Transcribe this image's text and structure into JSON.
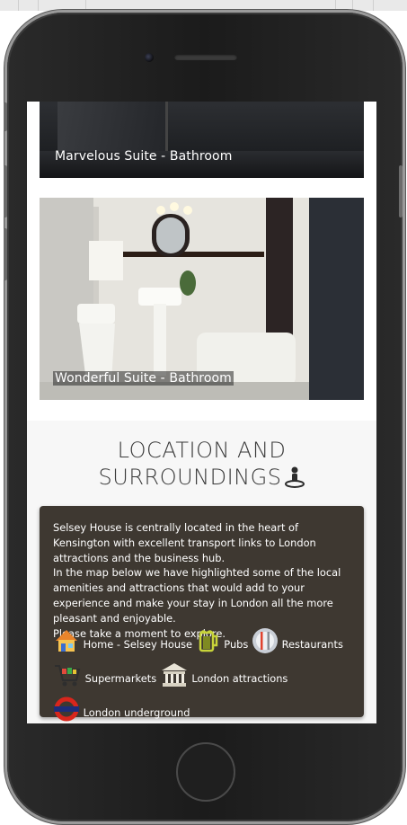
{
  "gallery": {
    "photo1_caption": "Marvelous Suite - Bathroom",
    "photo2_caption": "Wonderful Suite - Bathroom"
  },
  "location": {
    "title_line1": "LOCATION AND",
    "title_line2": "SURROUNDINGS",
    "para1": "Selsey House is centrally located in the heart of Kensington with excellent transport links to London attractions and the business hub.",
    "para2": "In the map below we have highlighted some of the local amenities and attractions that would add to your experience and make your stay in London all the more pleasant and enjoyable.",
    "para3": "Please take a moment to explore.",
    "legend": {
      "home": "Home - Selsey House",
      "pubs": "Pubs",
      "restaurants": "Restaurants",
      "supermarkets": "Supermarkets",
      "attractions": "London attractions",
      "underground": "London underground"
    }
  },
  "colors": {
    "card_bg": "#3e3831",
    "section_bg": "#f7f7f7",
    "title_color": "#3a3a3a"
  }
}
